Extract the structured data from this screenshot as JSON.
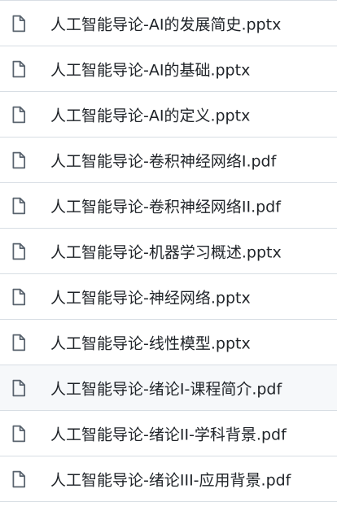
{
  "files": [
    {
      "name": "人工智能导论-AI的发展简史.pptx",
      "icon": "file-icon"
    },
    {
      "name": "人工智能导论-AI的基础.pptx",
      "icon": "file-icon"
    },
    {
      "name": "人工智能导论-AI的定义.pptx",
      "icon": "file-icon"
    },
    {
      "name": "人工智能导论-卷积神经网络I.pdf",
      "icon": "file-icon"
    },
    {
      "name": "人工智能导论-卷积神经网络II.pdf",
      "icon": "file-icon"
    },
    {
      "name": "人工智能导论-机器学习概述.pptx",
      "icon": "file-icon"
    },
    {
      "name": "人工智能导论-神经网络.pptx",
      "icon": "file-icon"
    },
    {
      "name": "人工智能导论-线性模型.pptx",
      "icon": "file-icon"
    },
    {
      "name": "人工智能导论-绪论I-课程简介.pdf",
      "icon": "file-icon",
      "highlighted": true
    },
    {
      "name": "人工智能导论-绪论II-学科背景.pdf",
      "icon": "file-icon"
    },
    {
      "name": "人工智能导论-绪论III-应用背景.pdf",
      "icon": "file-icon"
    }
  ],
  "colors": {
    "text": "#1f2328",
    "icon": "#59636e",
    "border": "#d8dee4",
    "row_highlight": "#f6f8fa"
  }
}
